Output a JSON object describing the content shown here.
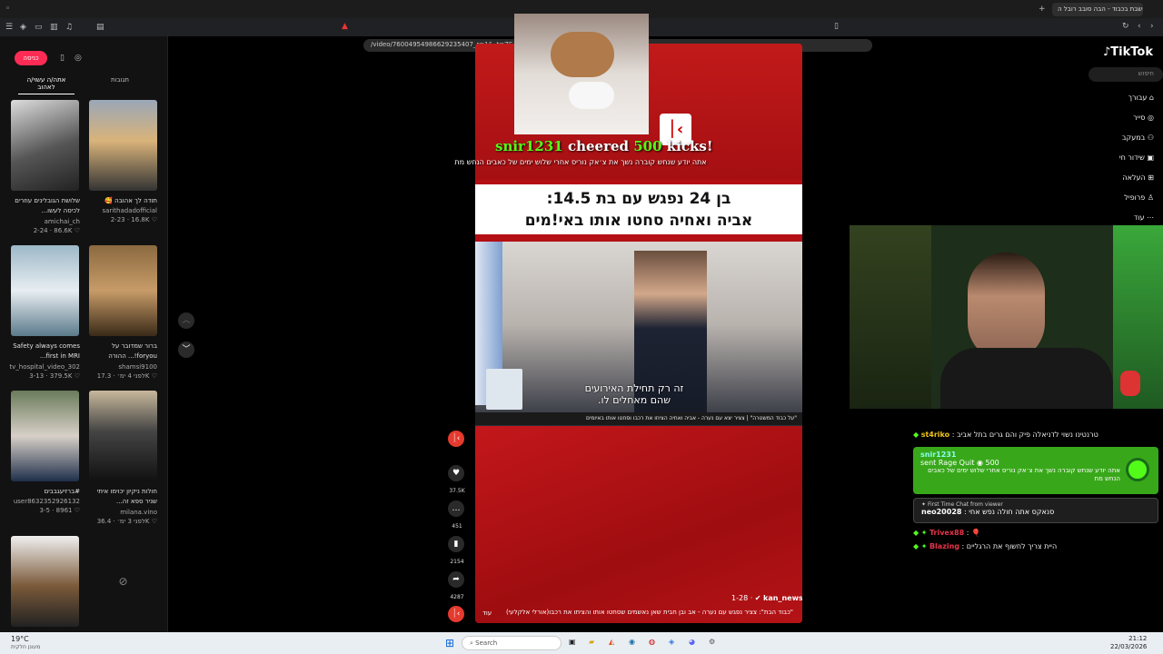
{
  "browser": {
    "tab_title": "מחשבת בכבוד - הבה סובב רובל ה...",
    "url": "/video/76004954986629235407_r=1&_t=ZS-94ttrN1vhkT"
  },
  "left": {
    "login_button": "כניסה",
    "tab_liked": "אתה/ה עשוי/ה לאהוב",
    "tab_replies": "תגובות",
    "videos": [
      {
        "caption": "שלושת הגובלינים עוזרים לכיסה לעשו...",
        "user": "amichai_ch",
        "date": "2-24",
        "views": "86.6K"
      },
      {
        "caption": "תודה לך אהובה 🥰",
        "user": "sarithadadofficial",
        "date": "2-23",
        "views": "16.8K"
      },
      {
        "caption": "Safety always comes first in MRI...",
        "user": "tv_hospital_video_302",
        "date": "3-13",
        "views": "379.5K"
      },
      {
        "caption": "ברור שמדובר על foryou!... ההורה",
        "user": "shamsi9100",
        "date": "לפני 4 ימ׳",
        "views": "17.3K"
      },
      {
        "caption": "#ברזיעגבבים",
        "user": "user8632352926132",
        "date": "3-5",
        "views": "8961"
      },
      {
        "caption": "חולות ניקיון יכוימו איתי שניר ספא זה...",
        "user": "milana.vino",
        "date": "לפני 3 ימ׳",
        "views": "36.4K"
      }
    ]
  },
  "overlay": {
    "user": "snir1231",
    "action": "cheered",
    "amount": "500",
    "unit": "kicks!",
    "message": "אתה יודע שנחש קוברה נשך את צ׳אק נוריס אחרי שלוש ימים של כאבים הנחש מת"
  },
  "video": {
    "headline1": "בן 24 נפגש עם בת 14.5:",
    "headline2": "אביה ואחיה סחטו אותו באי!מים",
    "subtitle1": "זה רק תחילת האירועים",
    "subtitle2": "שהם מאחלים לו.",
    "ticker": "\"על כבוד המשטרה\" | צציר יצא עם נערה - אביה ואחיה הציחו את רכבו וסחטו אותו באיומים",
    "channel_date": "1-28",
    "channel": "kan_news",
    "caption": "\"כבוד הבת\": צציר נפגש עם נערה - אב ובן חבית שאן נאשמים שסחטו אותו והציתו את רכבו(אורלי אלקלעי)",
    "more": "עוד"
  },
  "actions": {
    "likes": "37.5K",
    "comments": "451",
    "saves": "2154",
    "shares": "4287"
  },
  "nav": {
    "logo": "TikTok",
    "search": "חיפוש",
    "items": [
      "עבורך",
      "סייר",
      "במעקב",
      "שידור חי",
      "העלאה",
      "פרופיל",
      "עוד"
    ]
  },
  "chat": [
    {
      "user": "st4riko",
      "text": "טרנטינו נשוי לדניאלה פיק והם גרים בתל אביב"
    },
    {
      "user": "snir1231",
      "text": "sent Rage Quit",
      "amount": "500",
      "msg": "אתה יודע שנחש קוברה נשך את צ׳אק נוריס אחרי שלוש ימים של כאבים הנחש מת"
    },
    {
      "label": "First Time Chat from viewer",
      "user": "neo20028",
      "text": "סנאקס אתה חולה נפש אחי"
    },
    {
      "user": "Trivex88",
      "text": "🎈"
    },
    {
      "user": "Blazing",
      "text": "היית צריך לחשוף את הרגליים"
    }
  ],
  "taskbar": {
    "weather": "19°C",
    "weather_sub": "מעונן חלקית",
    "search": "Search",
    "time": "21:12",
    "date": "22/03/2026"
  },
  "colors": {
    "accent": "#fe2c55",
    "kick": "#53fc18",
    "red": "#b30f14"
  }
}
